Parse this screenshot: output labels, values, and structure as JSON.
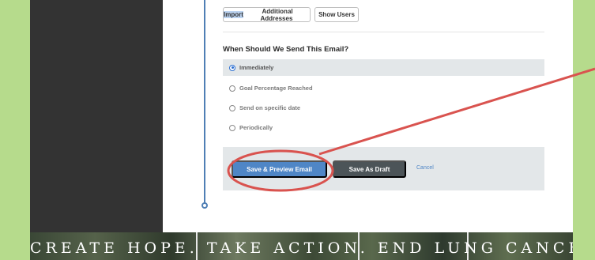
{
  "actions": {
    "import_label": "Import Additional Addresses",
    "show_users_label": "Show Users"
  },
  "send_section": {
    "title": "When Should We Send This Email?",
    "options": [
      {
        "label": "Immediately",
        "selected": true
      },
      {
        "label": "Goal Percentage Reached",
        "selected": false
      },
      {
        "label": "Send on specific date",
        "selected": false
      },
      {
        "label": "Periodically",
        "selected": false
      }
    ]
  },
  "footer": {
    "save_preview_label": "Save & Preview Email",
    "save_draft_label": "Save As Draft",
    "cancel_label": "Cancel"
  },
  "banner": {
    "text": "CREATE HOPE. TAKE ACTION. END LUNG CANCER."
  },
  "colors": {
    "primary": "#4f86c6",
    "annotation": "#d9534f",
    "page_bg": "#b6db8c"
  }
}
